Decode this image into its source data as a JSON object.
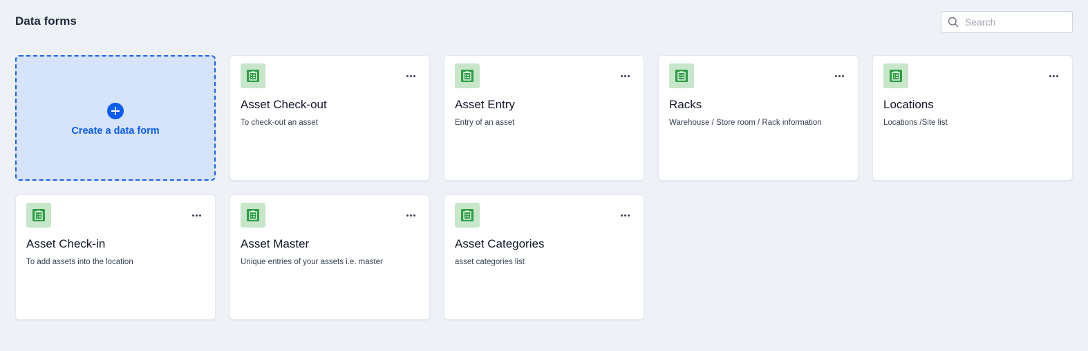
{
  "header": {
    "title": "Data forms",
    "search_placeholder": "Search",
    "search_value": ""
  },
  "create_card": {
    "label": "Create a data form"
  },
  "forms": [
    {
      "title": "Asset Check-out",
      "description": "To check-out an asset"
    },
    {
      "title": "Asset Entry",
      "description": "Entry of an asset"
    },
    {
      "title": "Racks",
      "description": "Warehouse / Store room / Rack information"
    },
    {
      "title": "Locations",
      "description": "Locations /Site list"
    },
    {
      "title": "Asset Check-in",
      "description": "To add assets into the location"
    },
    {
      "title": "Asset Master",
      "description": "Unique entries of your assets i.e. master"
    },
    {
      "title": "Asset Categories",
      "description": "asset categories list"
    }
  ],
  "icons": {
    "search": "search-icon",
    "create": "plus-circle-icon",
    "form": "clipboard-form-icon",
    "more": "more-horizontal-icon"
  },
  "colors": {
    "page_background": "#eef2f7",
    "accent": "#0b5cf0",
    "create_card_background": "#d5e4fb",
    "form_icon_background": "#c8e6c9",
    "form_icon_foreground": "#2e9e45"
  }
}
